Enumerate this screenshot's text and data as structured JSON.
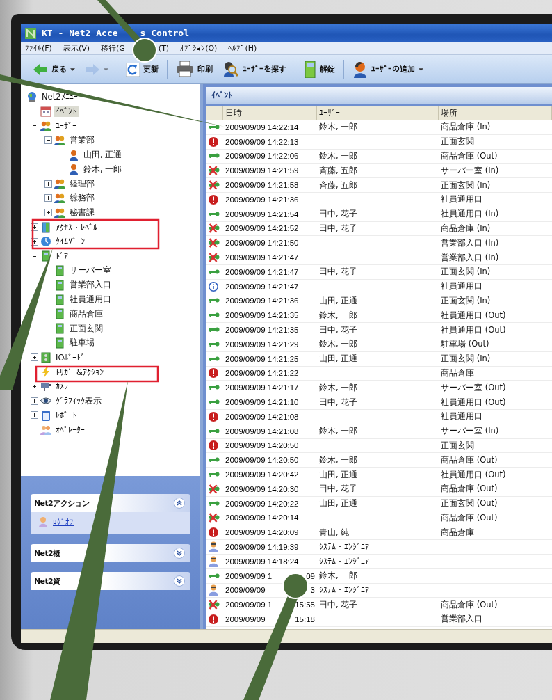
{
  "window": {
    "title": "KT - Net2 Acce",
    "title_tail": "s Control"
  },
  "menu": [
    "ﾌｧｲﾙ(F)",
    "表示(V)",
    "移行(G",
    "(T)",
    "ｵﾌﾟｼｮﾝ(O)",
    "ﾍﾙﾌﾟ(H)"
  ],
  "toolbar": [
    {
      "kind": "back",
      "label": "戻る",
      "dropdown": true,
      "disabled": false
    },
    {
      "kind": "forward",
      "dropdown": true,
      "disabled": true
    },
    {
      "kind": "refresh",
      "label": "更新",
      "dropdown": false,
      "disabled": false
    },
    {
      "kind": "print",
      "label": "印刷",
      "dropdown": false,
      "disabled": false
    },
    {
      "kind": "find",
      "label": "ﾕｰｻﾞｰを探す",
      "dropdown": false,
      "disabled": false
    },
    {
      "kind": "unlock",
      "label": "解錠",
      "dropdown": false,
      "disabled": false
    },
    {
      "kind": "add",
      "label": "ﾕｰｻﾞｰの追加",
      "dropdown": true,
      "disabled": false
    }
  ],
  "tree": {
    "label": "Net2ﾒﾆｭｰ",
    "kind": "menu",
    "selected": false,
    "children": [
      {
        "label": "ｲﾍﾞﾝﾄ",
        "kind": "event",
        "selected": true
      },
      {
        "label": "ﾕｰｻﾞｰ",
        "kind": "group",
        "selected": false,
        "expanded": true,
        "children": [
          {
            "label": "営業部",
            "kind": "group",
            "selected": false,
            "expanded": true,
            "children": [
              {
                "label": "山田, 正通",
                "kind": "person",
                "selected": false
              },
              {
                "label": "鈴木, 一郎",
                "kind": "person",
                "selected": false
              }
            ]
          },
          {
            "label": "経理部",
            "kind": "group",
            "selected": false,
            "expanded": false
          },
          {
            "label": "総務部",
            "kind": "group",
            "selected": false,
            "expanded": false
          },
          {
            "label": "秘書課",
            "kind": "group",
            "selected": false,
            "expanded": false
          }
        ]
      },
      {
        "label": "ｱｸｾｽ・ﾚﾍﾞﾙ",
        "kind": "level",
        "selected": false,
        "expanded": false
      },
      {
        "label": "ﾀｲﾑｿﾞｰﾝ",
        "kind": "zone",
        "selected": false,
        "expanded": false
      },
      {
        "label": "ﾄﾞｱ",
        "kind": "door",
        "selected": false,
        "expanded": true,
        "children": [
          {
            "label": "サーバー室",
            "kind": "door",
            "selected": false
          },
          {
            "label": "営業部入口",
            "kind": "door",
            "selected": false
          },
          {
            "label": "社員通用口",
            "kind": "door",
            "selected": false
          },
          {
            "label": "商品倉庫",
            "kind": "door",
            "selected": false
          },
          {
            "label": "正面玄関",
            "kind": "door",
            "selected": false
          },
          {
            "label": "駐車場",
            "kind": "door",
            "selected": false
          }
        ]
      },
      {
        "label": "IOﾎﾞｰﾄﾞ",
        "kind": "board",
        "selected": false,
        "expanded": false
      },
      {
        "label": "ﾄﾘｶﾞｰ&ｱｸｼｮﾝ",
        "kind": "trigger",
        "selected": false
      },
      {
        "label": "ｶﾒﾗ",
        "kind": "camera",
        "selected": false,
        "expanded": false
      },
      {
        "label": "ｸﾞﾗﾌｨｯｸ表示",
        "kind": "graphic",
        "selected": false,
        "expanded": false
      },
      {
        "label": "ﾚﾎﾟｰﾄ",
        "kind": "report",
        "selected": false,
        "expanded": false
      },
      {
        "label": "ｵﾍﾟﾚｰﾀｰ",
        "kind": "operator",
        "selected": false
      }
    ]
  },
  "task_pane": [
    {
      "title": "Net2アクション",
      "expanded": true,
      "links": [
        "ﾛｸﾞｵﾌ"
      ]
    },
    {
      "title": "Net2概",
      "expanded": false
    },
    {
      "title": "Net2資",
      "expanded": false
    }
  ],
  "events": {
    "title": "ｲﾍﾞﾝﾄ",
    "columns": [
      "日時",
      "ﾕｰｻﾞｰ",
      "場所"
    ],
    "rows": [
      {
        "kind": "granted",
        "date": "2009/09/09 14:22:14",
        "user": "鈴木, 一郎",
        "place": "商品倉庫 (In)"
      },
      {
        "kind": "alarm",
        "date": "2009/09/09 14:22:13",
        "user": "",
        "place": "正面玄関"
      },
      {
        "kind": "granted",
        "date": "2009/09/09 14:22:06",
        "user": "鈴木, 一郎",
        "place": "商品倉庫 (Out)"
      },
      {
        "kind": "denied",
        "date": "2009/09/09 14:21:59",
        "user": "斉藤, 五郎",
        "place": "サーバー室 (In)"
      },
      {
        "kind": "denied",
        "date": "2009/09/09 14:21:58",
        "user": "斉藤, 五郎",
        "place": "正面玄関 (In)"
      },
      {
        "kind": "alarm",
        "date": "2009/09/09 14:21:36",
        "user": "",
        "place": "社員通用口"
      },
      {
        "kind": "granted",
        "date": "2009/09/09 14:21:54",
        "user": "田中, 花子",
        "place": "社員通用口 (In)"
      },
      {
        "kind": "denied",
        "date": "2009/09/09 14:21:52",
        "user": "田中, 花子",
        "place": "商品倉庫 (In)"
      },
      {
        "kind": "denied",
        "date": "2009/09/09 14:21:50",
        "user": "",
        "place": "営業部入口 (In)"
      },
      {
        "kind": "denied",
        "date": "2009/09/09 14:21:47",
        "user": "",
        "place": "営業部入口 (In)"
      },
      {
        "kind": "granted",
        "date": "2009/09/09 14:21:47",
        "user": "田中, 花子",
        "place": "正面玄関 (In)"
      },
      {
        "kind": "info",
        "date": "2009/09/09 14:21:47",
        "user": "",
        "place": "社員通用口"
      },
      {
        "kind": "granted",
        "date": "2009/09/09 14:21:36",
        "user": "山田, 正通",
        "place": "正面玄関 (In)"
      },
      {
        "kind": "granted",
        "date": "2009/09/09 14:21:35",
        "user": "鈴木, 一郎",
        "place": "社員通用口 (Out)"
      },
      {
        "kind": "granted",
        "date": "2009/09/09 14:21:35",
        "user": "田中, 花子",
        "place": "社員通用口 (Out)"
      },
      {
        "kind": "granted",
        "date": "2009/09/09 14:21:29",
        "user": "鈴木, 一郎",
        "place": "駐車場 (Out)"
      },
      {
        "kind": "granted",
        "date": "2009/09/09 14:21:25",
        "user": "山田, 正通",
        "place": "正面玄関 (In)"
      },
      {
        "kind": "alarm",
        "date": "2009/09/09 14:21:22",
        "user": "",
        "place": "商品倉庫"
      },
      {
        "kind": "granted",
        "date": "2009/09/09 14:21:17",
        "user": "鈴木, 一郎",
        "place": "サーバー室 (Out)"
      },
      {
        "kind": "granted",
        "date": "2009/09/09 14:21:10",
        "user": "田中, 花子",
        "place": "社員通用口 (Out)"
      },
      {
        "kind": "alarm",
        "date": "2009/09/09 14:21:08",
        "user": "",
        "place": "社員通用口"
      },
      {
        "kind": "granted",
        "date": "2009/09/09 14:21:08",
        "user": "鈴木, 一郎",
        "place": "サーバー室 (In)"
      },
      {
        "kind": "alarm",
        "date": "2009/09/09 14:20:50",
        "user": "",
        "place": "正面玄関"
      },
      {
        "kind": "granted",
        "date": "2009/09/09 14:20:50",
        "user": "鈴木, 一郎",
        "place": "商品倉庫 (Out)"
      },
      {
        "kind": "granted",
        "date": "2009/09/09 14:20:42",
        "user": "山田, 正通",
        "place": "社員通用口 (Out)"
      },
      {
        "kind": "denied",
        "date": "2009/09/09 14:20:30",
        "user": "田中, 花子",
        "place": "商品倉庫 (Out)"
      },
      {
        "kind": "granted",
        "date": "2009/09/09 14:20:22",
        "user": "山田, 正通",
        "place": "正面玄関 (Out)"
      },
      {
        "kind": "denied",
        "date": "2009/09/09 14:20:14",
        "user": "",
        "place": "商品倉庫 (Out)"
      },
      {
        "kind": "alarm",
        "date": "2009/09/09 14:20:09",
        "user": "青山, 純一",
        "place": "商品倉庫"
      },
      {
        "kind": "operator",
        "date": "2009/09/09 14:19:39",
        "user": "ｼｽﾃﾑ・ｴﾝｼﾞﾆｱ",
        "place": ""
      },
      {
        "kind": "operator",
        "date": "2009/09/09 14:18:24",
        "user": "ｼｽﾃﾑ・ｴﾝｼﾞﾆｱ",
        "place": ""
      },
      {
        "kind": "granted",
        "date": "2009/09/09 1",
        "date_tail": "09",
        "user": "鈴木, 一郎",
        "place": ""
      },
      {
        "kind": "operator",
        "date": "2009/09/09",
        "date_tail": "3",
        "user": "ｼｽﾃﾑ・ｴﾝｼﾞﾆｱ",
        "place": ""
      },
      {
        "kind": "denied",
        "date": "2009/09/09 1",
        "date_tail": "15:55",
        "user": "田中, 花子",
        "place": "商品倉庫 (Out)"
      },
      {
        "kind": "alarm",
        "date": "2009/09/09",
        "date_tail": "15:18",
        "user": "",
        "place": "営業部入口"
      }
    ]
  }
}
